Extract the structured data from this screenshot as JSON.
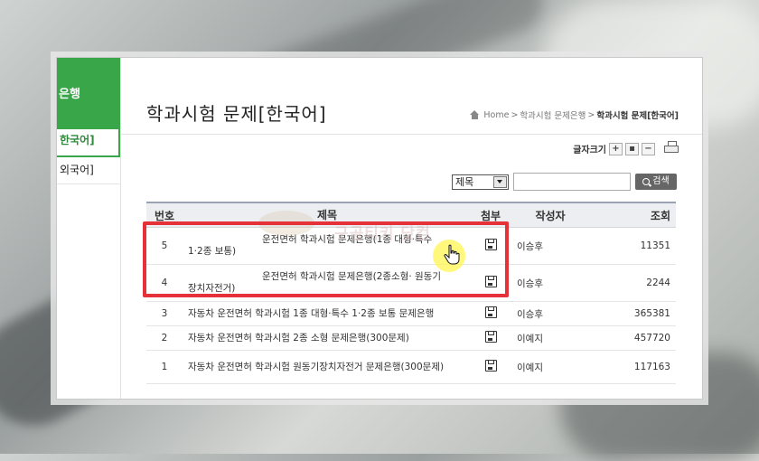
{
  "sidebar": {
    "head": "은행",
    "items": [
      {
        "label": "한국어]",
        "active": true
      },
      {
        "label": "외국어]",
        "active": false
      }
    ]
  },
  "page": {
    "title": "학과시험 문제[한국어]",
    "breadcrumb": [
      "Home",
      "학과시험 문제은행",
      "학과시험 문제[한국어]"
    ]
  },
  "toolbar": {
    "font_size_label": "글자크기",
    "font_buttons": [
      "+",
      "▪",
      "−"
    ]
  },
  "search": {
    "select_value": "제목",
    "input_value": "",
    "button_label": "검색"
  },
  "table": {
    "headers": [
      "번호",
      "제목",
      "첨부",
      "작성자",
      "조회"
    ],
    "rows": [
      {
        "no": "5",
        "title_a": "운전면허 학과시험 문제은행(1종 대형·특수",
        "title_b": "1·2종 보통)",
        "author": "이승후",
        "views": "11351"
      },
      {
        "no": "4",
        "title_a": "운전면허 학과시험 문제은행(2종소형· 원동기",
        "title_b": "장치자전거)",
        "author": "이승후",
        "views": "2244"
      },
      {
        "no": "3",
        "title": "자동차 운전면허 학과시험 1종 대형·특수 1·2종 보통 문제은행",
        "author": "이승후",
        "views": "365381"
      },
      {
        "no": "2",
        "title": "자동차 운전면허 학과시험 2종 소형 문제은행(300문제)",
        "author": "이예지",
        "views": "457720"
      },
      {
        "no": "1",
        "title": "자동차 운전면허 학과시험 원동기장치자전거 문제은행(300문제)",
        "author": "이예지",
        "views": "117163"
      }
    ]
  },
  "watermark": "구공티키 닷컴",
  "colors": {
    "accent": "#3aa64a",
    "highlight": "#e53238",
    "header_border": "#9aa3b3"
  }
}
